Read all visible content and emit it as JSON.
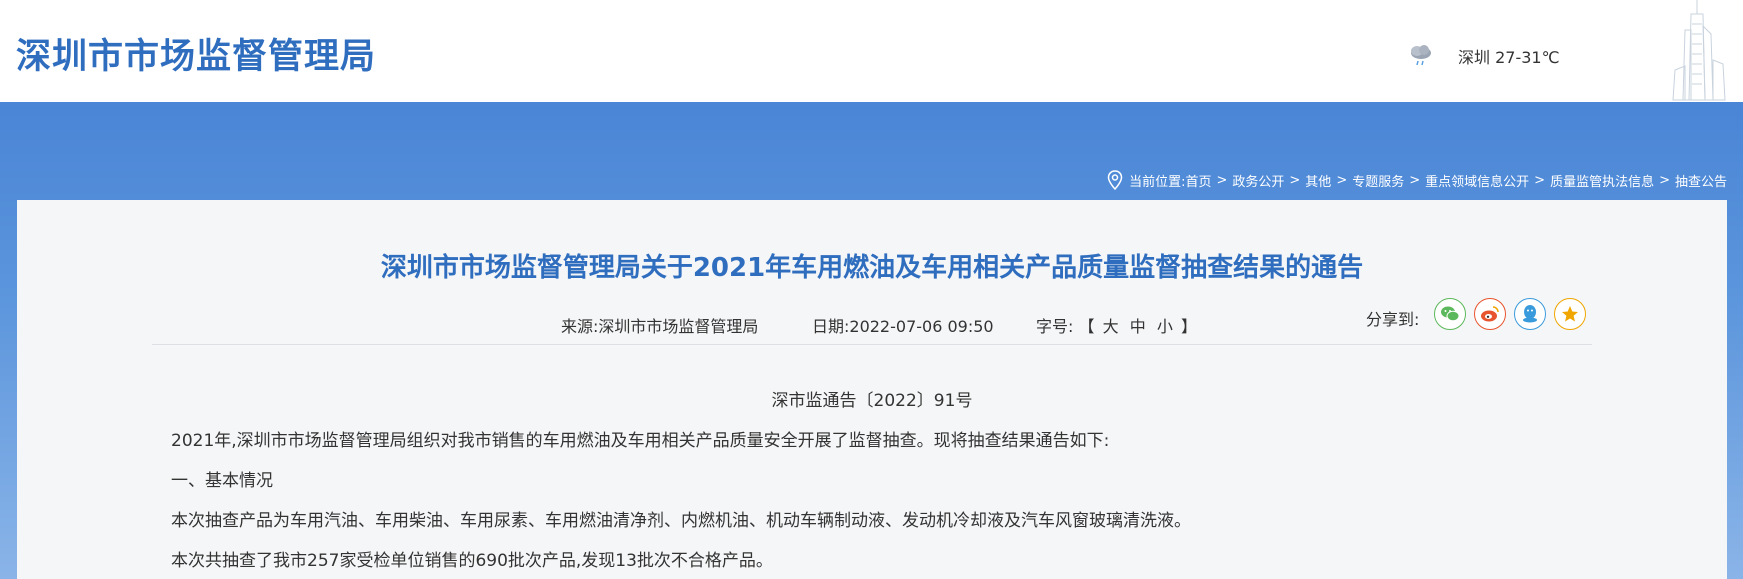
{
  "header": {
    "site_title": "深圳市市场监督管理局",
    "weather": "深圳 27-31℃"
  },
  "breadcrumb": {
    "prefix": "当前位置:",
    "items": [
      "首页",
      "政务公开",
      "其他",
      "专题服务",
      "重点领域信息公开",
      "质量监管执法信息",
      "抽查公告"
    ],
    "separator": ">"
  },
  "article": {
    "title": "深圳市市场监督管理局关于2021年车用燃油及车用相关产品质量监督抽查结果的通告",
    "source": "来源:深圳市市场监督管理局",
    "date": "日期:2022-07-06 09:50",
    "font_size_label": "字号:",
    "font_size_open": "【",
    "font_size_options": [
      "大",
      "中",
      "小"
    ],
    "font_size_close": "】",
    "share_label": "分享到:",
    "doc_number": "深市监通告〔2022〕91号",
    "paragraphs": [
      "2021年,深圳市市场监督管理局组织对我市销售的车用燃油及车用相关产品质量安全开展了监督抽查。现将抽查结果通告如下:",
      "一、基本情况",
      "本次抽查产品为车用汽油、车用柴油、车用尿素、车用燃油清净剂、内燃机油、机动车辆制动液、发动机冷却液及汽车风窗玻璃清洗液。",
      "本次共抽查了我市257家受检单位销售的690批次产品,发现13批次不合格产品。"
    ]
  },
  "colors": {
    "brand_blue": "#2f6dbf",
    "band_blue": "#4a85d6"
  }
}
